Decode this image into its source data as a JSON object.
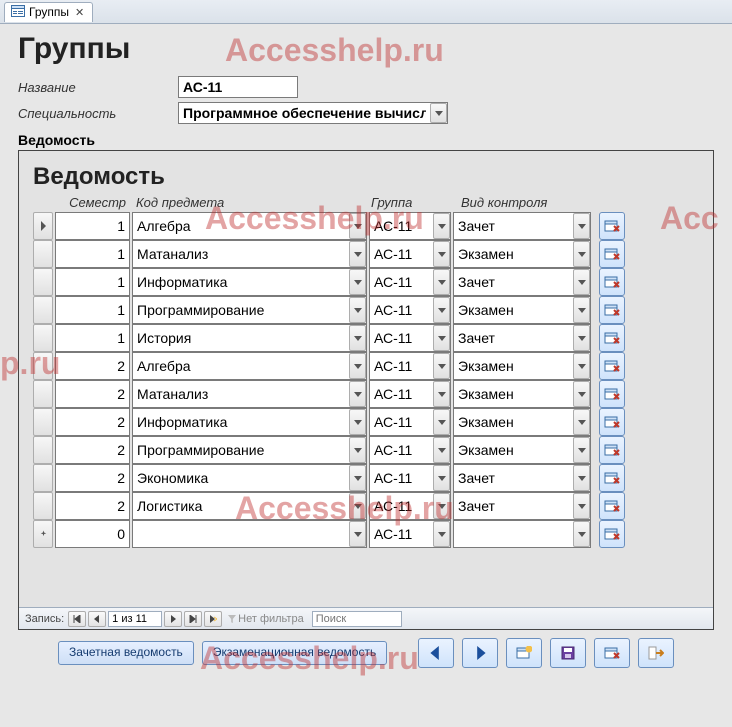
{
  "watermark": "Accesshelp.ru",
  "tab": {
    "label": "Группы"
  },
  "title": "Группы",
  "fields": {
    "name_label": "Название",
    "name_value": "АС-11",
    "spec_label": "Специальность",
    "spec_value": "Программное обеспечение вычислит"
  },
  "subform": {
    "heading": "Ведомость",
    "title": "Ведомость",
    "columns": {
      "semester": "Семестр",
      "subject": "Код предмета",
      "group": "Группа",
      "control": "Вид контроля"
    },
    "rows": [
      {
        "sem": "1",
        "subj": "Алгебра",
        "grp": "АС-11",
        "ctrl": "Зачет"
      },
      {
        "sem": "1",
        "subj": "Матанализ",
        "grp": "АС-11",
        "ctrl": "Экзамен"
      },
      {
        "sem": "1",
        "subj": "Информатика",
        "grp": "АС-11",
        "ctrl": "Зачет"
      },
      {
        "sem": "1",
        "subj": "Программирование",
        "grp": "АС-11",
        "ctrl": "Экзамен"
      },
      {
        "sem": "1",
        "subj": "История",
        "grp": "АС-11",
        "ctrl": "Зачет"
      },
      {
        "sem": "2",
        "subj": "Алгебра",
        "grp": "АС-11",
        "ctrl": "Экзамен"
      },
      {
        "sem": "2",
        "subj": "Матанализ",
        "grp": "АС-11",
        "ctrl": "Экзамен"
      },
      {
        "sem": "2",
        "subj": "Информатика",
        "grp": "АС-11",
        "ctrl": "Экзамен"
      },
      {
        "sem": "2",
        "subj": "Программирование",
        "grp": "АС-11",
        "ctrl": "Экзамен"
      },
      {
        "sem": "2",
        "subj": "Экономика",
        "grp": "АС-11",
        "ctrl": "Зачет"
      },
      {
        "sem": "2",
        "subj": "Логистика",
        "grp": "АС-11",
        "ctrl": "Зачет"
      }
    ],
    "new_row": {
      "sem": "0",
      "subj": "",
      "grp": "АС-11",
      "ctrl": ""
    },
    "recnav": {
      "label": "Запись:",
      "pos": "1 из 11",
      "no_filter": "Нет фильтра",
      "search_ph": "Поиск"
    }
  },
  "buttons": {
    "zachet": "Зачетная ведомость",
    "exam": "Экзаменационная ведомость"
  }
}
